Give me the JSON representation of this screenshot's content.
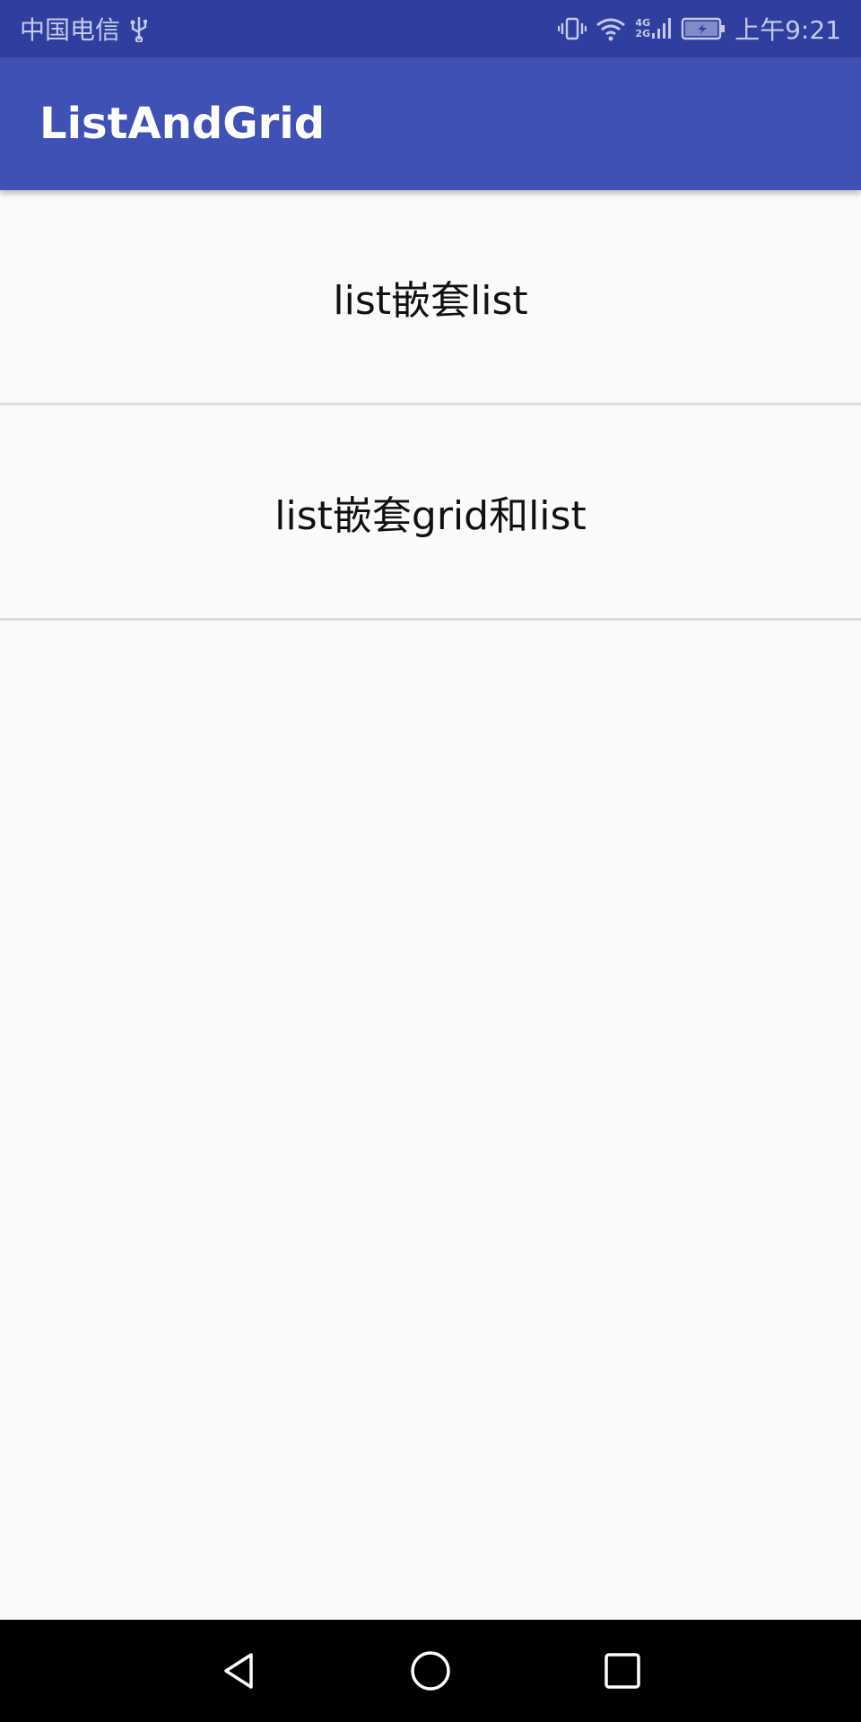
{
  "status_bar": {
    "carrier": "中国电信",
    "network_label_top": "4G",
    "network_label_bottom": "2G",
    "time": "上午9:21",
    "icons": [
      "usb-icon",
      "vibrate-icon",
      "wifi-icon",
      "signal-icon",
      "battery-charging-icon"
    ]
  },
  "app_bar": {
    "title": "ListAndGrid"
  },
  "list": {
    "items": [
      {
        "label": "list嵌套list"
      },
      {
        "label": "list嵌套grid和list"
      }
    ]
  },
  "nav_bar": {
    "icons": [
      "back-icon",
      "home-icon",
      "recents-icon"
    ]
  },
  "colors": {
    "status_bar": "#303f9f",
    "app_bar": "#3f51b5",
    "background": "#fafafa",
    "divider": "#dcdcdc",
    "nav_bar": "#000000"
  }
}
